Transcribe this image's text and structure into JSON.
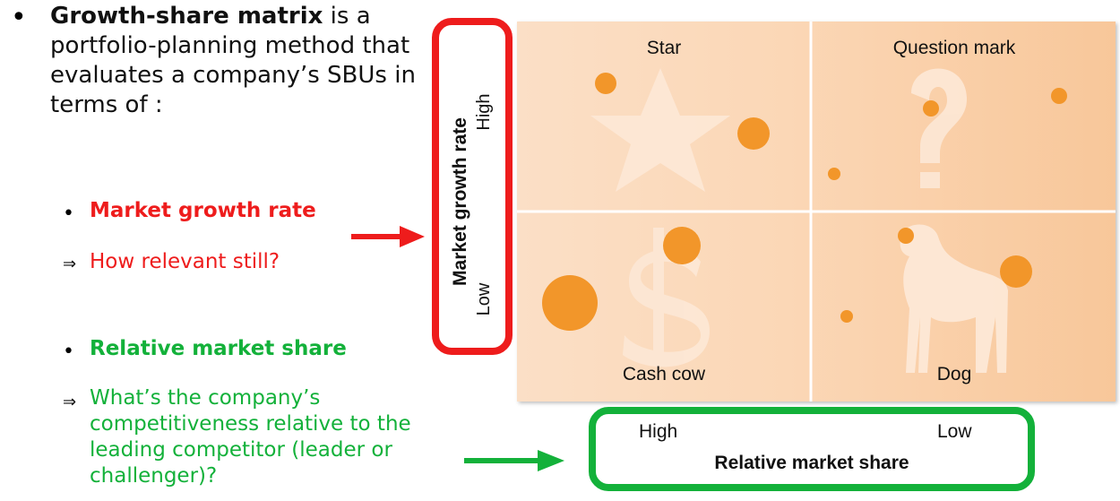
{
  "intro": {
    "bullet": "•",
    "bold": "Growth-share matrix",
    "rest": " is a portfolio-planning method that evaluates a company’s SBUs in terms of :"
  },
  "items": [
    {
      "dot": "•",
      "label": "Market growth rate",
      "arrow": "⇒",
      "explanation": "How relevant still?"
    },
    {
      "dot": "•",
      "label": "Relative market share",
      "arrow": "⇒",
      "explanation": "What’s the company’s competitiveness relative to the leading competitor (leader or challenger)?"
    }
  ],
  "matrix": {
    "quadrants": {
      "top_left": "Star",
      "top_right": "Question mark",
      "bottom_left": "Cash cow",
      "bottom_right": "Dog"
    },
    "y_axis": {
      "title": "Market growth rate",
      "high": "High",
      "low": "Low"
    },
    "x_axis": {
      "title": "Relative market share",
      "high": "High",
      "low": "Low"
    }
  },
  "colors": {
    "red": "#ee1c1c",
    "green": "#13b13a",
    "bubble": "#f2962a",
    "background_light": "#fbdfc6",
    "background_dark": "#f8c79a"
  }
}
